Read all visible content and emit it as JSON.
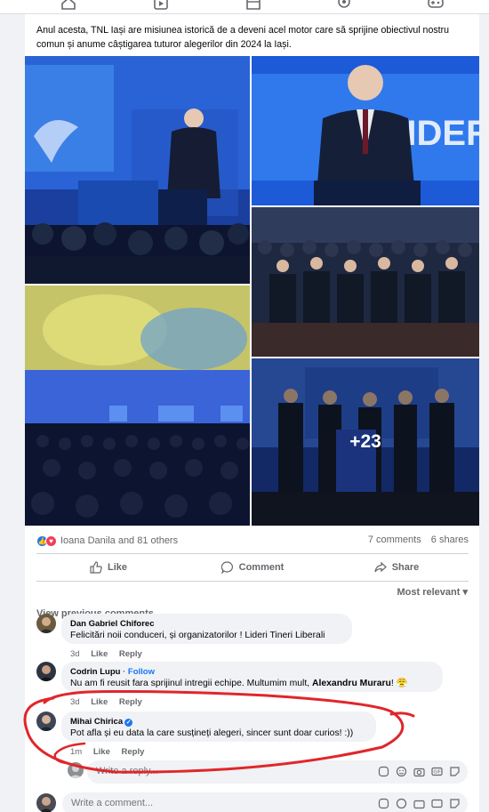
{
  "post": {
    "text": "Anul acesta, TNL Iași are misiunea istorică de a deveni acel motor care să sprijine obiectivul nostru comun și anume câștigarea tuturor alegerilor din 2024 la Iași.",
    "more_photos": "+23",
    "stage_banner": "LIDERI TINERI"
  },
  "stats": {
    "reactions": "Ioana Danila and 81 others",
    "comments": "7 comments",
    "shares": "6 shares"
  },
  "actions": {
    "like": "Like",
    "comment": "Comment",
    "share": "Share"
  },
  "sort": "Most relevant ▾",
  "view_previous": "View previous comments",
  "comments": [
    {
      "name": "Dan Gabriel Chiforec",
      "text": "Felicitări noii conduceri, și organizatorilor ! Lideri Tineri Liberali",
      "time": "3d",
      "like": "Like",
      "reply": "Reply"
    },
    {
      "name": "Codrin Lupu",
      "follow": "· Follow",
      "text_before": "Nu am fi reusit fara sprijinul intregii echipe. Multumim mult, ",
      "mention": "Alexandru Muraru",
      "text_after": "! 😤",
      "time": "3d",
      "like": "Like",
      "reply": "Reply"
    },
    {
      "name": "Mihai Chirica",
      "text": "Pot afla și eu data la care susțineți alegeri, sincer sunt doar curios! :))",
      "time": "1m",
      "like": "Like",
      "reply": "Reply"
    }
  ],
  "reply_input": {
    "placeholder": "Write a reply..."
  },
  "comment_input": {
    "placeholder": "Write a comment..."
  },
  "colors": {
    "accent": "#1877f2",
    "annotation": "#e0262a",
    "stage_blue": "#1d5ad8"
  }
}
